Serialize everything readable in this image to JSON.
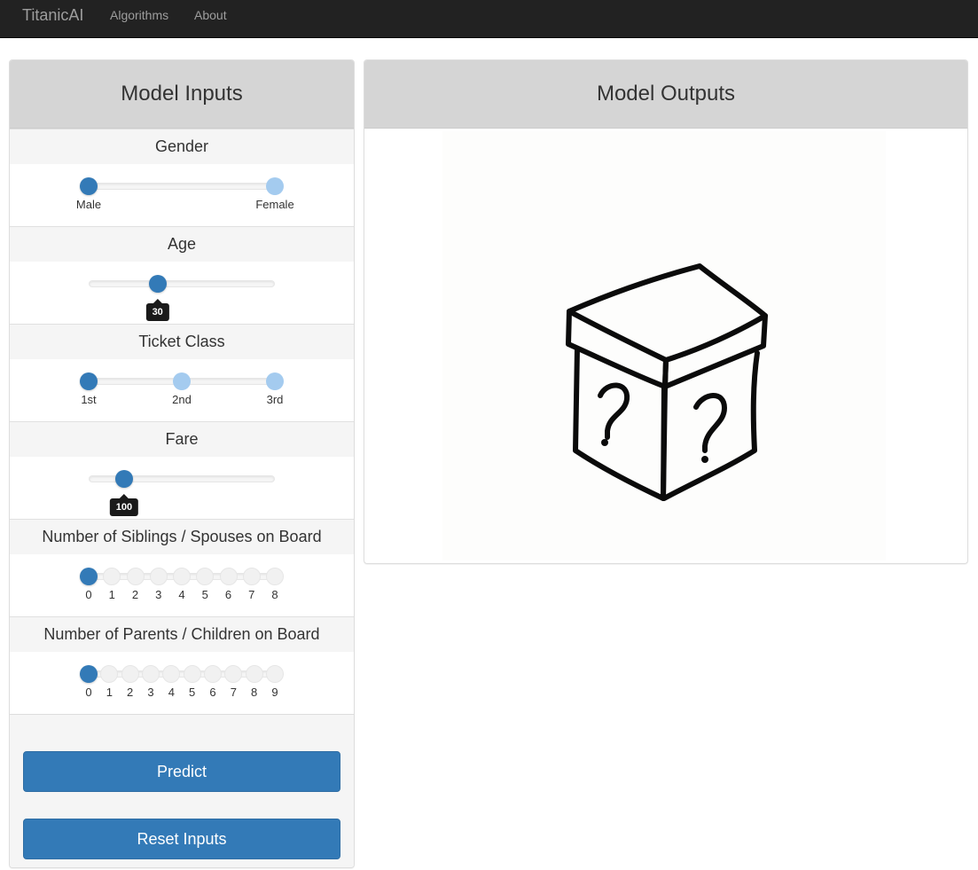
{
  "nav": {
    "brand": "TitanicAI",
    "links": [
      "Algorithms",
      "About"
    ]
  },
  "inputs_panel": {
    "title": "Model Inputs",
    "gender": {
      "label": "Gender",
      "options": [
        "Male",
        "Female"
      ],
      "selected": "Male"
    },
    "age": {
      "label": "Age",
      "value": "30",
      "fraction": 0.37
    },
    "ticket_class": {
      "label": "Ticket Class",
      "options": [
        "1st",
        "2nd",
        "3rd"
      ],
      "selected": "1st"
    },
    "fare": {
      "label": "Fare",
      "value": "100",
      "fraction": 0.19
    },
    "siblings": {
      "label": "Number of Siblings / Spouses on Board",
      "options": [
        "0",
        "1",
        "2",
        "3",
        "4",
        "5",
        "6",
        "7",
        "8"
      ],
      "selected": "0"
    },
    "parents": {
      "label": "Number of Parents / Children on Board",
      "options": [
        "0",
        "1",
        "2",
        "3",
        "4",
        "5",
        "6",
        "7",
        "8",
        "9"
      ],
      "selected": "0"
    },
    "predict_label": "Predict",
    "reset_label": "Reset Inputs"
  },
  "outputs_panel": {
    "title": "Model Outputs",
    "image_icon": "mystery-box-icon"
  },
  "colors": {
    "navbar": "#222222",
    "primary": "#337ab7",
    "inactive_dot": "#a4cbef",
    "panel_heading": "#d5d5d5"
  }
}
